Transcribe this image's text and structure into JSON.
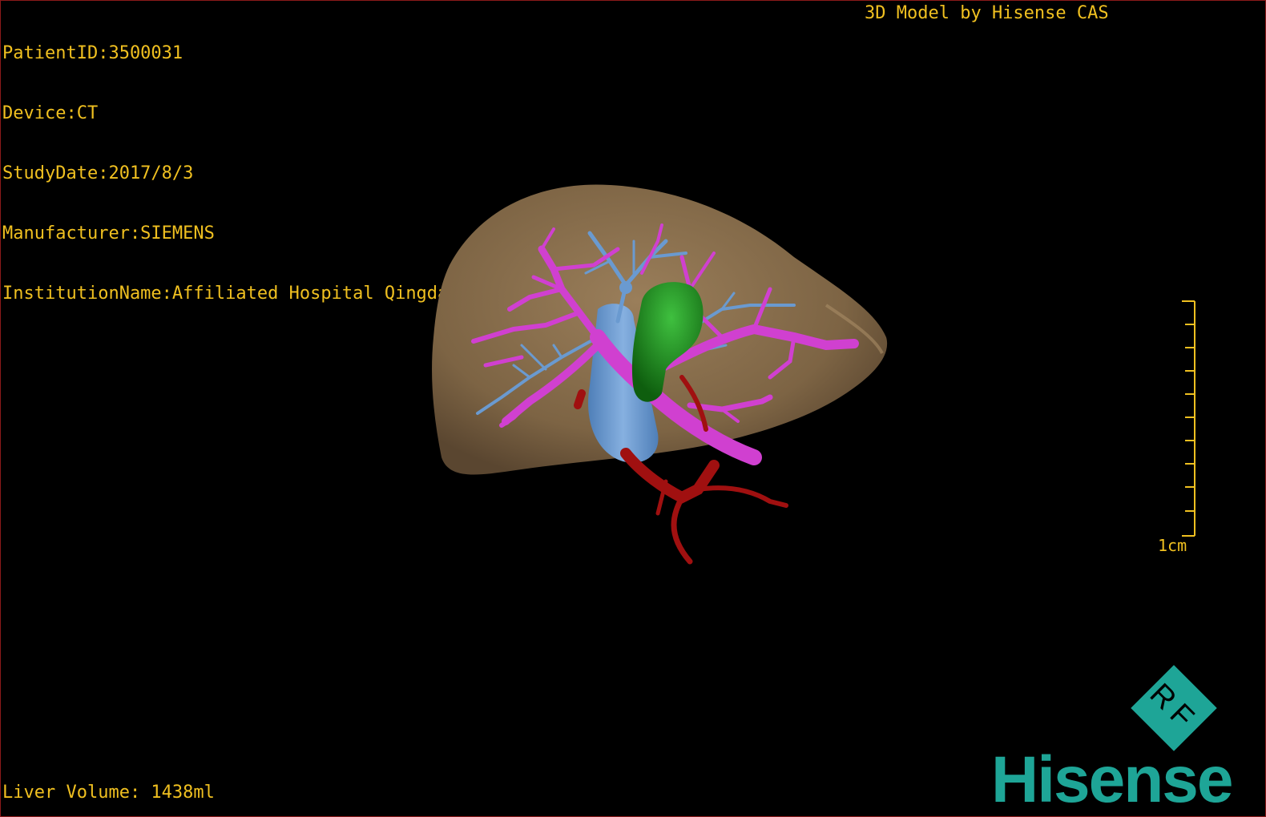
{
  "info": {
    "patient_id": "PatientID:3500031",
    "device": "Device:CT",
    "study_date": "StudyDate:2017/8/3",
    "manufacturer": "Manufacturer:SIEMENS",
    "institution": "InstitutionName:Affiliated Hospital Qingdao University-C"
  },
  "brand_caption": "3D Model by Hisense CAS",
  "scale_bar": {
    "label": "1cm"
  },
  "liver_volume": "Liver Volume: 1438ml",
  "logo": {
    "wordmark": "Hisense",
    "badge": "RF",
    "color": "#1ea597"
  },
  "colors": {
    "overlay_text": "#f0c020",
    "liver": "#8a7050",
    "portal_vein": "#d040d0",
    "hepatic_vein": "#6a9ad0",
    "ivc": "#6a9ad0",
    "gallbladder": "#1a8a1a",
    "artery": "#a01010"
  }
}
